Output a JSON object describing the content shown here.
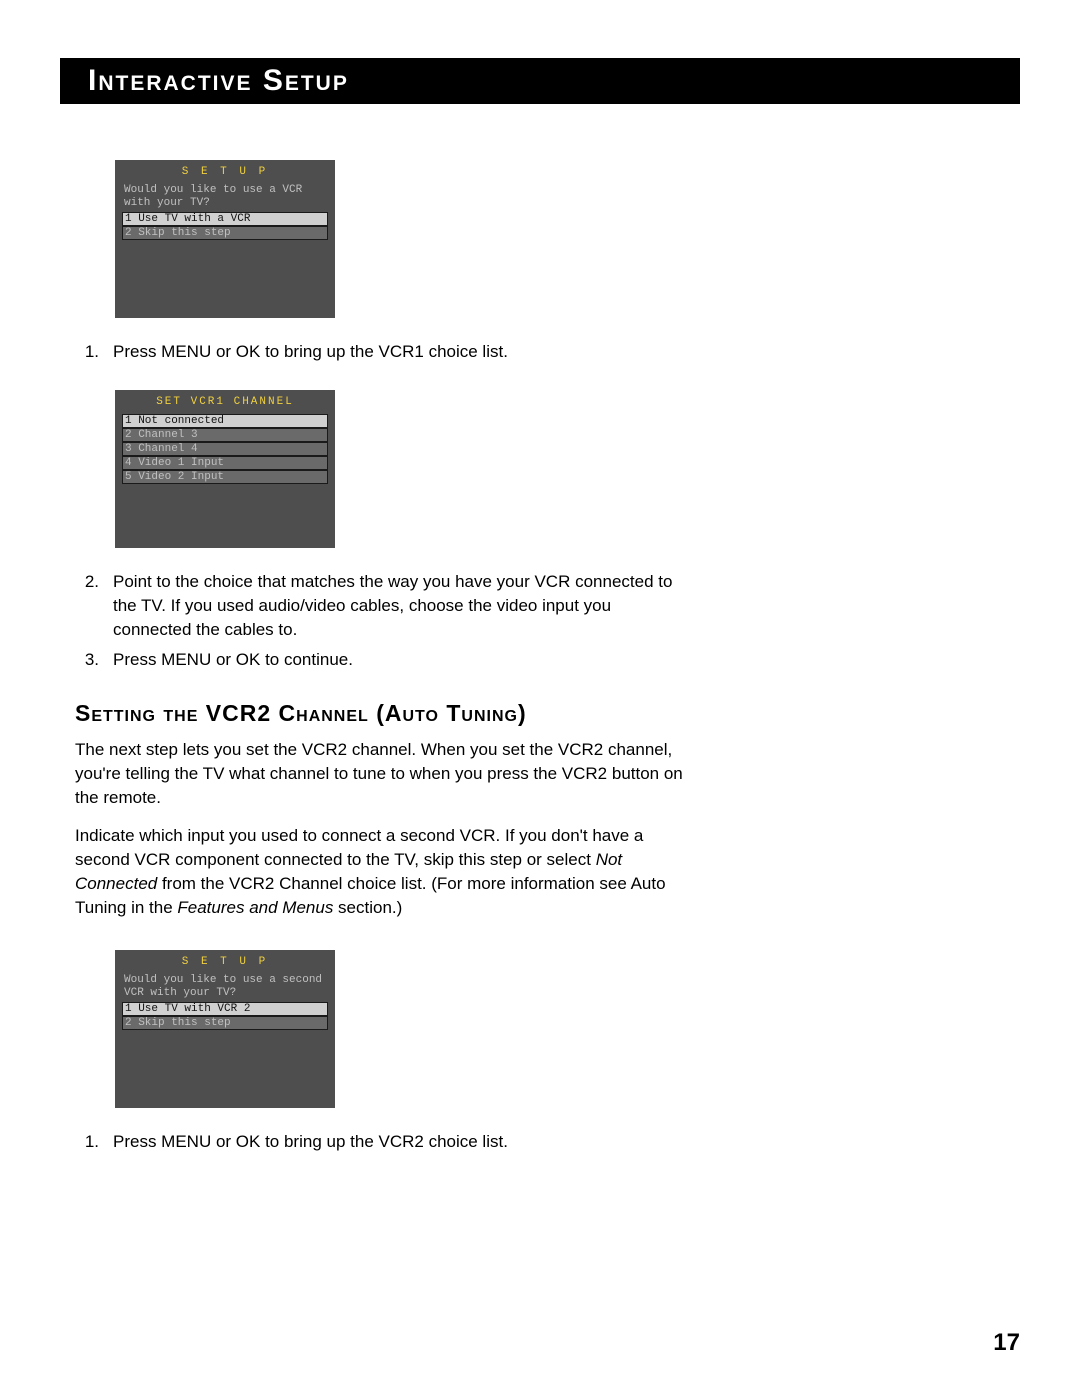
{
  "header": "Interactive Setup",
  "screen1": {
    "title": "S E T U P",
    "question": "Would you like to use a VCR with your TV?",
    "items": [
      {
        "label": "1 Use TV with a VCR",
        "selected": true
      },
      {
        "label": "2 Skip this step",
        "selected": false
      }
    ]
  },
  "instructions1": [
    "Press MENU or OK to bring up the VCR1 choice list."
  ],
  "screen2": {
    "title": "SET VCR1 CHANNEL",
    "items": [
      {
        "label": "1 Not connected",
        "selected": true
      },
      {
        "label": "2 Channel 3",
        "selected": false
      },
      {
        "label": "3 Channel 4",
        "selected": false
      },
      {
        "label": "4 Video 1 Input",
        "selected": false
      },
      {
        "label": "5 Video 2 Input",
        "selected": false
      }
    ]
  },
  "instructions2": [
    "Point to the choice that matches the way you have your VCR connected to the TV. If you used audio/video cables, choose the video input you connected the cables to.",
    "Press MENU or OK to continue."
  ],
  "section_heading": "Setting the VCR2 Channel (Auto Tuning)",
  "para1_a": "The next step lets you set the VCR2 channel. When you set the VCR2 channel, you're telling the TV what channel to tune to when you press the VCR2 button on the remote.",
  "para2_pre": "Indicate which input you used to connect a second VCR.  If you don't have a second VCR component connected to the TV, skip this step or select ",
  "para2_em1": "Not Connected",
  "para2_mid": " from the VCR2 Channel choice list. (For more information see Auto Tuning in the ",
  "para2_em2": "Features and Menus",
  "para2_post": " section.)",
  "screen3": {
    "title": "S E T U P",
    "question": "Would you like to use a second VCR with your TV?",
    "items": [
      {
        "label": "1 Use TV with VCR 2",
        "selected": true
      },
      {
        "label": "2 Skip this step",
        "selected": false
      }
    ]
  },
  "instructions3": [
    "Press MENU or OK to bring up the VCR2 choice list."
  ],
  "page_number": "17"
}
